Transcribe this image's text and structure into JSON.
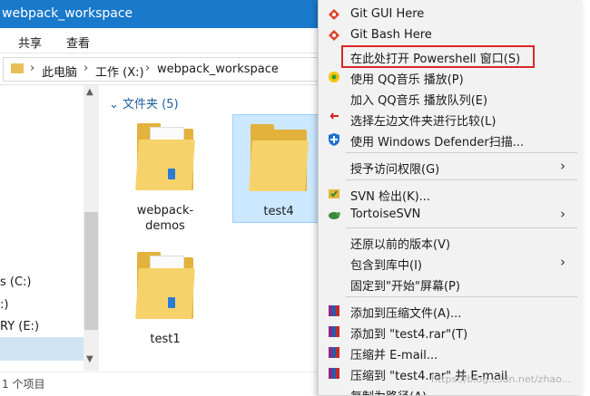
{
  "window": {
    "title": "webpack_workspace"
  },
  "ribbon": {
    "tabs": [
      "共享",
      "查看"
    ]
  },
  "address": {
    "segments": [
      "此电脑",
      "工作 (X:)",
      "webpack_workspace"
    ]
  },
  "nav": {
    "drives": [
      "s (C:)",
      ":)",
      "RY (E:)"
    ]
  },
  "content": {
    "group_label": "文件夹 (5)",
    "items": [
      {
        "name": "webpack-demos",
        "selected": false
      },
      {
        "name": "test4",
        "selected": true
      },
      {
        "name": "test1",
        "selected": false
      }
    ]
  },
  "status": {
    "text": "1 个项目"
  },
  "context_menu": {
    "items": [
      {
        "label": "Git GUI Here",
        "icon": "git-icon"
      },
      {
        "label": "Git Bash Here",
        "icon": "git-icon"
      },
      {
        "label": "在此处打开 Powershell 窗口(S)",
        "icon": "none",
        "highlighted": true
      },
      {
        "label": "使用 QQ音乐 播放(P)",
        "icon": "qq-music-icon"
      },
      {
        "label": "加入 QQ音乐 播放队列(E)",
        "icon": "none"
      },
      {
        "label": "选择左边文件夹进行比较(L)",
        "icon": "compare-icon"
      },
      {
        "label": "使用 Windows Defender扫描...",
        "icon": "defender-icon"
      },
      {
        "label": "授予访问权限(G)",
        "icon": "none",
        "submenu": true
      },
      {
        "label": "SVN 检出(K)...",
        "icon": "svn-icon"
      },
      {
        "label": "TortoiseSVN",
        "icon": "tortoise-icon",
        "submenu": true
      },
      {
        "label": "还原以前的版本(V)",
        "icon": "none"
      },
      {
        "label": "包含到库中(I)",
        "icon": "none",
        "submenu": true
      },
      {
        "label": "固定到\"开始\"屏幕(P)",
        "icon": "none"
      },
      {
        "label": "添加到压缩文件(A)...",
        "icon": "rar-icon"
      },
      {
        "label": "添加到 \"test4.rar\"(T)",
        "icon": "rar-icon"
      },
      {
        "label": "压缩并 E-mail...",
        "icon": "rar-icon"
      },
      {
        "label": "压缩到 \"test4.rar\" 并 E-mail",
        "icon": "rar-icon"
      },
      {
        "label": "复制为路径(A)",
        "icon": "none"
      }
    ]
  },
  "watermark": "https://blog.csdn.net/zhao..."
}
